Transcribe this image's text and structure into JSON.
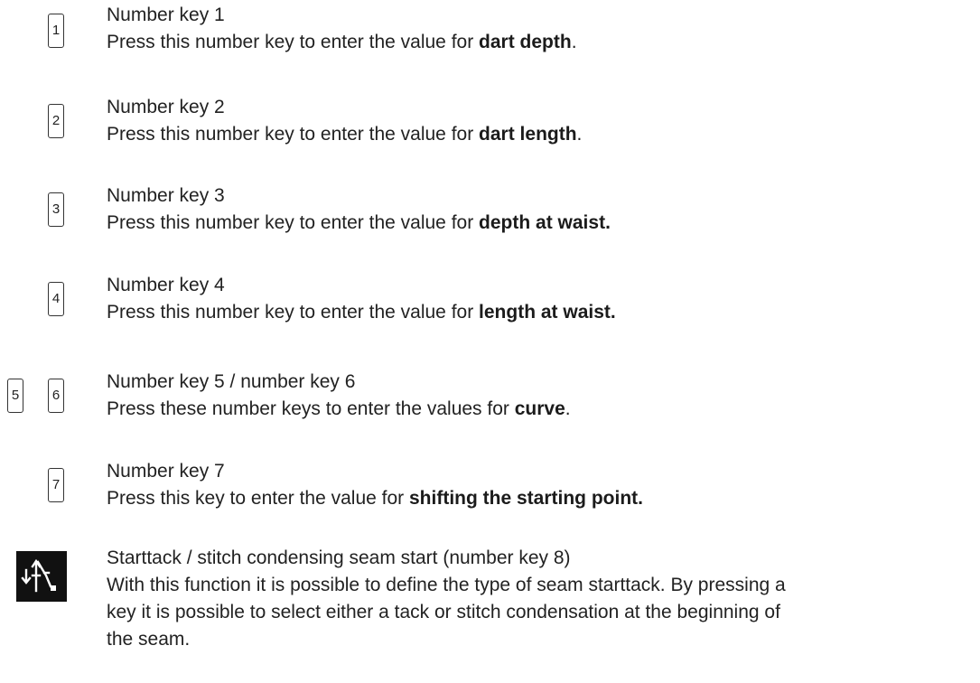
{
  "entries": [
    {
      "keys": [
        "1"
      ],
      "title": "Number key 1",
      "desc_pre": "Press this number key to enter the value for ",
      "desc_kw": "dart depth",
      "desc_post": "."
    },
    {
      "keys": [
        "2"
      ],
      "title": "Number key 2",
      "desc_pre": "Press this number key to enter the value for ",
      "desc_kw": "dart length",
      "desc_post": "."
    },
    {
      "keys": [
        "3"
      ],
      "title": "Number key 3",
      "desc_pre": "Press this number key to enter the value for ",
      "desc_kw": "depth at waist.",
      "desc_post": ""
    },
    {
      "keys": [
        "4"
      ],
      "title": "Number key 4",
      "desc_pre": "Press this number key to enter the value for ",
      "desc_kw": "length at waist.",
      "desc_post": ""
    },
    {
      "keys": [
        "5",
        "6"
      ],
      "title": "Number key 5 / number key 6",
      "desc_pre": "Press these number keys to enter the values for ",
      "desc_kw": "curve",
      "desc_post": "."
    },
    {
      "keys": [
        "7"
      ],
      "title": "Number key 7",
      "desc_pre": "Press this key to enter the value for ",
      "desc_kw": "shifting the starting point.",
      "desc_post": ""
    }
  ],
  "last": {
    "icon": "starttack-symbol-icon",
    "title": "Starttack / stitch condensing seam start",
    "title_suffix": " (number key 8)",
    "desc_line1": "With this function it is possible to define the type of seam starttack. By pressing a",
    "desc_line2": "key it is possible to select either a tack or stitch condensation at the beginning of",
    "desc_line3": "the seam."
  }
}
